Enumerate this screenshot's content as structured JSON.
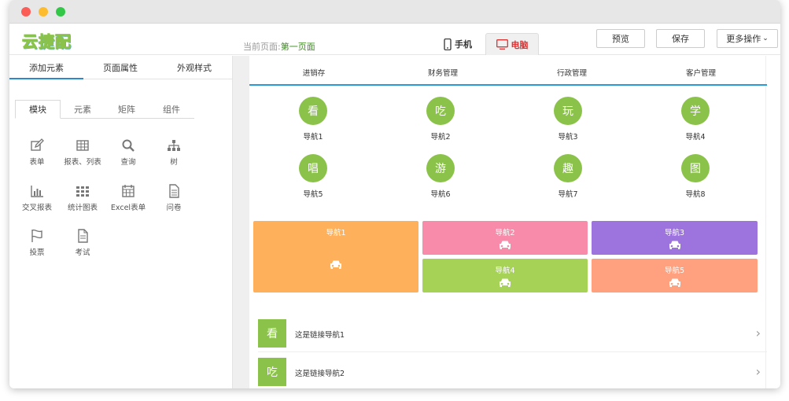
{
  "header": {
    "logo": "云捷配",
    "current_page_label": "当前页面:",
    "current_page_value": "第一页面",
    "device_phone": "手机",
    "device_pc": "电脑",
    "preview": "预览",
    "save": "保存",
    "more": "更多操作"
  },
  "left_tabs": [
    "添加元素",
    "页面属性",
    "外观样式"
  ],
  "sub_tabs": [
    "模块",
    "元素",
    "矩阵",
    "组件"
  ],
  "modules": [
    {
      "label": "表单",
      "icon": "edit-icon"
    },
    {
      "label": "报表、列表",
      "icon": "table-icon"
    },
    {
      "label": "查询",
      "icon": "search-icon"
    },
    {
      "label": "树",
      "icon": "tree-icon"
    },
    {
      "label": "交叉报表",
      "icon": "bar-chart-icon"
    },
    {
      "label": "统计图表",
      "icon": "grid-icon"
    },
    {
      "label": "Excel表单",
      "icon": "calendar-icon"
    },
    {
      "label": "问卷",
      "icon": "document-icon"
    },
    {
      "label": "投票",
      "icon": "flag-icon"
    },
    {
      "label": "考试",
      "icon": "file-icon"
    }
  ],
  "main_tabs": [
    "进销存",
    "财务管理",
    "行政管理",
    "客户管理"
  ],
  "circle_nav": [
    {
      "char": "看",
      "label": "导航1"
    },
    {
      "char": "吃",
      "label": "导航2"
    },
    {
      "char": "玩",
      "label": "导航3"
    },
    {
      "char": "学",
      "label": "导航4"
    },
    {
      "char": "唱",
      "label": "导航5"
    },
    {
      "char": "游",
      "label": "导航6"
    },
    {
      "char": "趣",
      "label": "导航7"
    },
    {
      "char": "图",
      "label": "导航8"
    }
  ],
  "cards": [
    {
      "label": "导航1",
      "color": "#ffb05a"
    },
    {
      "label": "导航2",
      "color": "#f78ba9"
    },
    {
      "label": "导航3",
      "color": "#9d73de"
    },
    {
      "label": "导航4",
      "color": "#a6d256"
    },
    {
      "label": "导航5",
      "color": "#ffa07e"
    }
  ],
  "links": [
    {
      "char": "看",
      "label": "这是链接导航1"
    },
    {
      "char": "吃",
      "label": "这是链接导航2"
    }
  ],
  "colors": {
    "accent": "#2a9ad6",
    "green": "#8bc34a"
  }
}
